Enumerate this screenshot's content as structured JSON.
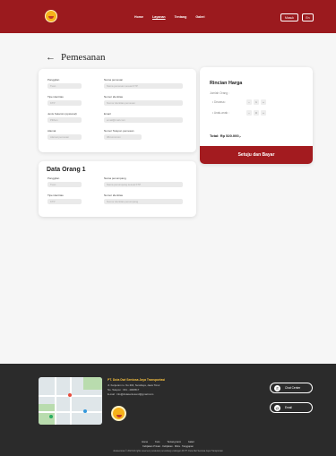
{
  "header": {
    "nav": [
      "Home",
      "Layanan",
      "Tentang",
      "Galeri"
    ],
    "login_label": "Masuk",
    "lang_label": "En"
  },
  "page": {
    "back_icon": "arrow-left-icon",
    "title": "Pemesanan"
  },
  "booking_form": {
    "fields": [
      {
        "label": "Panggilan",
        "value": "Tuan"
      },
      {
        "label": "Nama pemesan",
        "placeholder": "Nama pemesan sesuai KTP"
      },
      {
        "label": "Tipe identitas",
        "value": "KTP"
      },
      {
        "label": "Nomor identitas",
        "placeholder": "Nomor identitas pemesan"
      },
      {
        "label": "Jenis Kelamin (opsional)",
        "value": "Pilihan"
      },
      {
        "label": "Email",
        "placeholder": "email@mail.com"
      },
      {
        "label": "Alamat",
        "placeholder": "Alamat pemesan"
      },
      {
        "label": "Nomor Telepon pemesan",
        "placeholder": "08xxxxxxxxx"
      }
    ]
  },
  "passenger": {
    "title": "Data Orang 1",
    "fields": [
      {
        "label": "Panggilan",
        "value": "Tuan"
      },
      {
        "label": "Nama penumpang",
        "placeholder": "Nama penumpang sesuai KTP"
      },
      {
        "label": "Tipe identitas",
        "value": "KTP"
      },
      {
        "label": "Nomor identitas",
        "placeholder": "Nomor identitas penumpang"
      }
    ]
  },
  "price": {
    "title": "Rincian Harga",
    "count_label": "Jumlah Orang :",
    "rows": [
      {
        "label": "• Dewasa :",
        "value": "1"
      },
      {
        "label": "• Anak-anak :",
        "value": "0"
      }
    ],
    "minus": "−",
    "plus": "+",
    "total": "Total: Rp 520.000,-",
    "pay_label": "Setuju dan Bayar"
  },
  "footer": {
    "company": "PT. Duta Dwi Sentosa Jaya Transportasi",
    "address": "Jl. Kenjeran no. No.304, Surabaya, Jawa Timur",
    "phone": "No. Telepon : 031 - 4000517",
    "email": "E-mail : info@dutasentosa.id@gmail.com",
    "chat_label": "Chat Center",
    "email_label": "Email",
    "links": [
      "Home",
      "Kurs",
      "Tentang kami",
      "Galeri"
    ],
    "links2": "Kebijakan Privasi · Kebijakan   ·  Mitra  ·  Tanggapan",
    "copyright": "dutasentosa © 2023 All rights reserved, peraturan perundang undangan RI PT. Duta Dwi Sentosa Jaya Transportasi",
    "colors": {
      "brand_red": "#9b1a1e",
      "footer_bg": "#2b2b2b",
      "accent_gold": "#f6c040"
    }
  }
}
